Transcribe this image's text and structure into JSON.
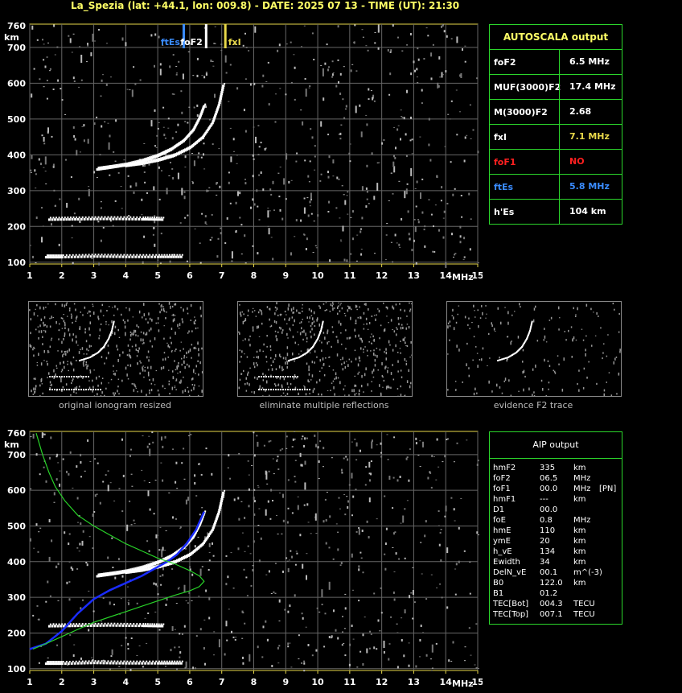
{
  "header": {
    "title": "La_Spezia (lat: +44.1, lon: 009.8) - DATE: 2025 07 13 - TIME (UT): 21:30"
  },
  "autoscala": {
    "title": "AUTOSCALA output",
    "rows": [
      {
        "key": "foF2",
        "value": "6.5 MHz",
        "key_color": "#ffffff",
        "value_color": "#ffffff"
      },
      {
        "key": "MUF(3000)F2",
        "value": "17.4 MHz",
        "key_color": "#ffffff",
        "value_color": "#ffffff"
      },
      {
        "key": "M(3000)F2",
        "value": "2.68",
        "key_color": "#ffffff",
        "value_color": "#ffffff"
      },
      {
        "key": "fxI",
        "value": "7.1 MHz",
        "key_color": "#ffffff",
        "value_color": "#e8d84a"
      },
      {
        "key": "foF1",
        "value": "NO",
        "key_color": "#ff2020",
        "value_color": "#ff2020"
      },
      {
        "key": "ftEs",
        "value": "5.8 MHz",
        "key_color": "#3a8cff",
        "value_color": "#3a8cff"
      },
      {
        "key": "h'Es",
        "value": "104     km",
        "key_color": "#ffffff",
        "value_color": "#ffffff"
      }
    ]
  },
  "aip": {
    "title": "AIP output",
    "rows": [
      {
        "param": "hmF2",
        "value": "335",
        "unit": "km",
        "extra": ""
      },
      {
        "param": "foF2",
        "value": "06.5",
        "unit": "MHz",
        "extra": ""
      },
      {
        "param": "foF1",
        "value": "00.0",
        "unit": "MHz",
        "extra": "[PN]"
      },
      {
        "param": "hmF1",
        "value": "---",
        "unit": "km",
        "extra": ""
      },
      {
        "param": "D1",
        "value": "00.0",
        "unit": "",
        "extra": ""
      },
      {
        "param": "foE",
        "value": "0.8",
        "unit": "MHz",
        "extra": ""
      },
      {
        "param": "hmE",
        "value": "110",
        "unit": "km",
        "extra": ""
      },
      {
        "param": "ymE",
        "value": "20",
        "unit": "km",
        "extra": ""
      },
      {
        "param": "h_vE",
        "value": "134",
        "unit": "km",
        "extra": ""
      },
      {
        "param": "Ewidth",
        "value": "34",
        "unit": "km",
        "extra": ""
      },
      {
        "param": "DelN_vE",
        "value": "00.1",
        "unit": "m^(-3)",
        "extra": ""
      },
      {
        "param": "B0",
        "value": "122.0",
        "unit": "km",
        "extra": ""
      },
      {
        "param": "B1",
        "value": "01.2",
        "unit": "",
        "extra": ""
      },
      {
        "param": "TEC[Bot]",
        "value": "004.3",
        "unit": "TECU",
        "extra": ""
      },
      {
        "param": "TEC[Top]",
        "value": "007.1",
        "unit": "TECU",
        "extra": ""
      }
    ]
  },
  "thumbnails": [
    {
      "caption": "original ionogram resized"
    },
    {
      "caption": "eliminate multiple reflections"
    },
    {
      "caption": "evidence F2 trace"
    }
  ],
  "chart_data": [
    {
      "type": "scatter",
      "title": "",
      "xlabel": "MHz",
      "ylabel": "km",
      "xlim": [
        1,
        15
      ],
      "ylim": [
        95,
        765
      ],
      "xticks": [
        "1",
        "2",
        "3",
        "4",
        "5",
        "6",
        "7",
        "8",
        "9",
        "10",
        "11",
        "12",
        "13",
        "14",
        "15"
      ],
      "yticks": [
        "100",
        "200",
        "300",
        "400",
        "500",
        "600",
        "700",
        "760"
      ],
      "grid": true,
      "markers": [
        {
          "name": "ftEs",
          "x": 5.8,
          "color": "#3a8cff"
        },
        {
          "name": "foF2",
          "x": 6.5,
          "color": "#ffffff"
        },
        {
          "name": "fxI",
          "x": 7.1,
          "color": "#e8d84a"
        }
      ],
      "traces": [
        {
          "name": "o-trace F2",
          "color": "#ffffff",
          "x": [
            3.1,
            3.5,
            4.0,
            4.5,
            5.0,
            5.4,
            5.8,
            6.1,
            6.3,
            6.45
          ],
          "y": [
            360,
            365,
            372,
            383,
            398,
            415,
            440,
            470,
            505,
            540
          ]
        },
        {
          "name": "x-trace F2",
          "color": "#ffffff",
          "x": [
            4.0,
            4.5,
            5.0,
            5.5,
            6.0,
            6.4,
            6.7,
            6.9,
            7.05
          ],
          "y": [
            370,
            376,
            385,
            398,
            420,
            450,
            490,
            540,
            600
          ]
        },
        {
          "name": "Es trace",
          "color": "#ffffff",
          "x": [
            1.5,
            2.0,
            3.0,
            4.0,
            5.0,
            5.8
          ],
          "y": [
            115,
            115,
            117,
            116,
            116,
            116
          ]
        },
        {
          "name": "Es 2nd hop",
          "color": "#ffffff",
          "x": [
            1.6,
            2.5,
            3.5,
            4.5,
            5.2
          ],
          "y": [
            220,
            221,
            222,
            221,
            220
          ]
        }
      ]
    },
    {
      "type": "line",
      "title": "",
      "xlabel": "MHz",
      "ylabel": "km",
      "xlim": [
        1,
        15
      ],
      "ylim": [
        95,
        765
      ],
      "xticks": [
        "1",
        "2",
        "3",
        "4",
        "5",
        "6",
        "7",
        "8",
        "9",
        "10",
        "11",
        "12",
        "13",
        "14",
        "15"
      ],
      "yticks": [
        "100",
        "200",
        "300",
        "400",
        "500",
        "600",
        "700",
        "760"
      ],
      "grid": true,
      "series": [
        {
          "name": "",
          "color": "#1a2cff",
          "x": [
            1.0,
            1.5,
            2.0,
            2.5,
            3.0,
            3.5,
            4.0,
            4.5,
            5.0,
            5.3,
            5.6,
            5.9,
            6.2,
            6.45
          ],
          "y": [
            155,
            170,
            205,
            255,
            295,
            320,
            340,
            360,
            385,
            400,
            420,
            450,
            490,
            540
          ]
        },
        {
          "name": "",
          "color": "#28d228",
          "x": [
            1.2,
            1.4,
            1.6,
            1.8,
            2.1,
            2.5,
            3.0,
            3.5,
            4.0,
            4.5,
            5.0,
            5.5,
            6.0,
            6.3,
            6.45,
            6.3,
            6.0,
            5.5,
            5.0,
            4.5,
            4.0,
            3.5,
            3.0,
            2.5,
            2.0,
            1.5,
            1.1
          ],
          "y": [
            760,
            700,
            650,
            610,
            570,
            530,
            500,
            475,
            450,
            430,
            410,
            395,
            375,
            360,
            345,
            330,
            318,
            305,
            290,
            275,
            260,
            245,
            230,
            210,
            190,
            170,
            155
          ]
        }
      ],
      "traces": [
        {
          "name": "o-trace F2",
          "color": "#ffffff",
          "x": [
            3.1,
            3.5,
            4.0,
            4.5,
            5.0,
            5.4,
            5.8,
            6.1,
            6.3,
            6.45
          ],
          "y": [
            360,
            365,
            372,
            383,
            398,
            415,
            440,
            470,
            505,
            540
          ]
        },
        {
          "name": "x-trace F2",
          "color": "#ffffff",
          "x": [
            4.0,
            4.5,
            5.0,
            5.5,
            6.0,
            6.4,
            6.7,
            6.9,
            7.05
          ],
          "y": [
            370,
            376,
            385,
            398,
            420,
            450,
            490,
            540,
            600
          ]
        },
        {
          "name": "Es trace",
          "color": "#ffffff",
          "x": [
            1.5,
            2.0,
            3.0,
            4.0,
            5.0,
            5.8
          ],
          "y": [
            115,
            115,
            117,
            116,
            116,
            116
          ]
        },
        {
          "name": "Es 2nd hop",
          "color": "#ffffff",
          "x": [
            1.6,
            2.5,
            3.5,
            4.5,
            5.2
          ],
          "y": [
            220,
            221,
            222,
            221,
            220
          ]
        }
      ]
    }
  ]
}
